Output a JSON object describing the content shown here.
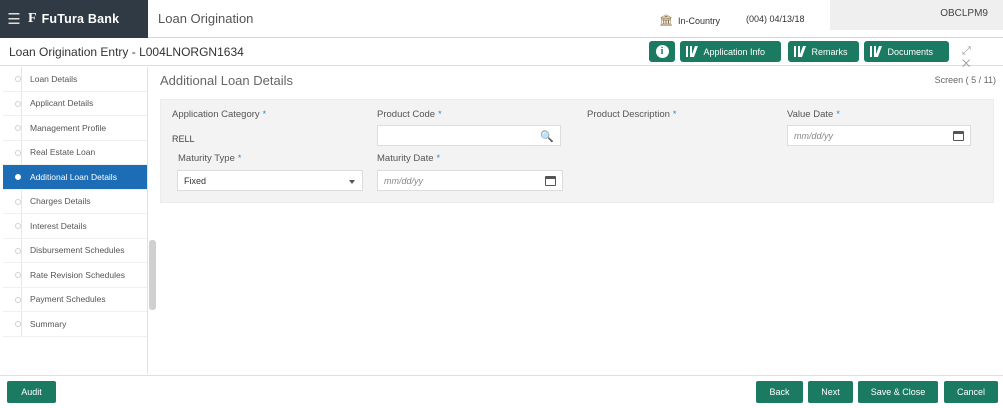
{
  "header": {
    "brand_name": "FuTura Bank",
    "brand_logo": "F",
    "app_title": "Loan Origination",
    "country": "In-Country",
    "branch_date": "(004)  04/13/18",
    "user_id": "OBCLPM9",
    "icons": [
      "hamburger-icon",
      "bank-icon"
    ]
  },
  "titlebar": {
    "title": "Loan Origination Entry - L004LNORGN1634",
    "buttons": {
      "info": "i",
      "application_info": "Application Info",
      "remarks": "Remarks",
      "documents": "Documents"
    },
    "window_controls": "⤢ ✕"
  },
  "sidebar": {
    "items": [
      {
        "label": "Loan Details",
        "active": false
      },
      {
        "label": "Applicant Details",
        "active": false
      },
      {
        "label": "Management Profile",
        "active": false
      },
      {
        "label": "Real Estate Loan",
        "active": false
      },
      {
        "label": "Additional Loan Details",
        "active": true
      },
      {
        "label": "Charges Details",
        "active": false
      },
      {
        "label": "Interest Details",
        "active": false
      },
      {
        "label": "Disbursement Schedules",
        "active": false
      },
      {
        "label": "Rate Revision Schedules",
        "active": false
      },
      {
        "label": "Payment Schedules",
        "active": false
      },
      {
        "label": "Summary",
        "active": false
      }
    ]
  },
  "main": {
    "section_title": "Additional Loan Details",
    "screen_count": "Screen ( 5 / 11)",
    "fields": {
      "application_category": {
        "label": "Application Category",
        "value": "RELL"
      },
      "product_code": {
        "label": "Product Code",
        "value": ""
      },
      "product_description": {
        "label": "Product Description",
        "value": ""
      },
      "value_date": {
        "label": "Value Date",
        "placeholder": "mm/dd/yy"
      },
      "maturity_type": {
        "label": "Maturity Type",
        "value": "Fixed"
      },
      "maturity_date": {
        "label": "Maturity Date",
        "placeholder": "mm/dd/yy"
      }
    },
    "required_marker": "*"
  },
  "footer": {
    "audit": "Audit",
    "back": "Back",
    "next": "Next",
    "save_close": "Save & Close",
    "cancel": "Cancel"
  },
  "colors": {
    "accent_green": "#1a7a62",
    "active_blue": "#1c6db5",
    "brand_dark": "#2f3a44"
  }
}
